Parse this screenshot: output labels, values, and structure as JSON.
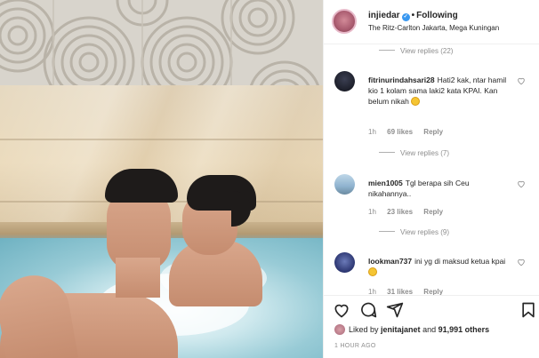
{
  "header": {
    "username": "injiedar",
    "following_label": "Following",
    "location": "The Ritz-Carlton Jakarta, Mega Kuningan"
  },
  "comments": {
    "top_view_replies": "View replies (22)",
    "items": [
      {
        "username": "fitrinurindahsari28",
        "text": "Hati2 kak, ntar hamil kio 1 kolam sama laki2 kata KPAI. Kan belum nikah",
        "time": "1h",
        "likes": "69 likes",
        "reply": "Reply",
        "view_replies": "View replies (7)"
      },
      {
        "username": "mien1005",
        "text": "Tgl berapa sih Ceu nikahannya..",
        "time": "1h",
        "likes": "23 likes",
        "reply": "Reply",
        "view_replies": "View replies (9)"
      },
      {
        "username": "lookman737",
        "text": "ini yg di maksud ketua kpai",
        "time": "1h",
        "likes": "31 likes",
        "reply": "Reply"
      }
    ]
  },
  "likes": {
    "prefix": "Liked by",
    "user": "jenitajanet",
    "and": "and",
    "others": "91,991 others"
  },
  "timestamp": "1 HOUR AGO",
  "colors": {
    "verified": "#3897f0",
    "muted": "#8e8e8e",
    "text": "#262626"
  }
}
